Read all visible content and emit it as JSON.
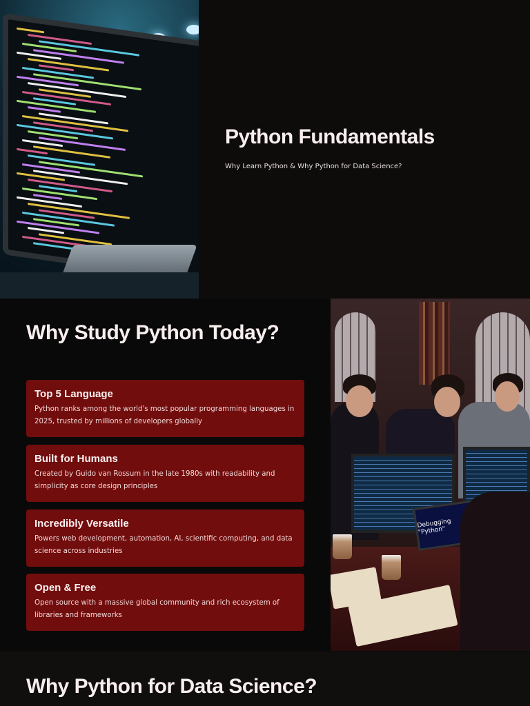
{
  "hero": {
    "title": "Python Fundamentals",
    "subtitle": "Why Learn Python & Why Python for Data Science?"
  },
  "why_study": {
    "heading": "Why Study Python Today?",
    "cards": [
      {
        "title": "Top 5 Language",
        "description": "Python ranks among the world's most popular programming languages in 2025, trusted by millions of developers globally"
      },
      {
        "title": "Built for Humans",
        "description": "Created by Guido van Rossum in the late 1980s with readability and simplicity as core design principles"
      },
      {
        "title": "Incredibly Versatile",
        "description": "Powers web development, automation, AI, scientific computing, and data science across industries"
      },
      {
        "title": "Open & Free",
        "description": "Open source with a massive global community and rich ecosystem of libraries and frameworks"
      }
    ]
  },
  "photo": {
    "laptop_text": "Debugging \"Python\""
  },
  "data_science": {
    "heading": "Why Python for Data Science?"
  },
  "colors": {
    "card": "#720d0d",
    "background": "#0b0a0a"
  }
}
